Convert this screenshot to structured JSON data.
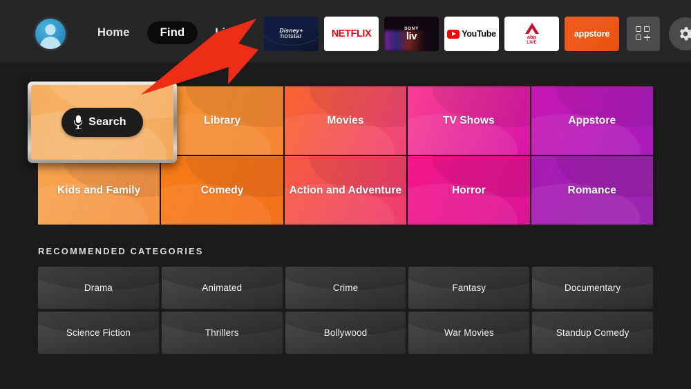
{
  "nav": {
    "avatar_name": "profile-avatar",
    "items": [
      {
        "label": "Home",
        "selected": false
      },
      {
        "label": "Find",
        "selected": true
      },
      {
        "label": "Live",
        "selected": false
      }
    ],
    "apps": [
      {
        "name": "disney-hotstar",
        "line1": "Disney+",
        "line2": "hotstar"
      },
      {
        "name": "netflix",
        "line1": "NETFLIX",
        "line2": ""
      },
      {
        "name": "sony-liv",
        "line1": "SONY",
        "line2": "liv"
      },
      {
        "name": "youtube",
        "line1": "YouTube",
        "line2": ""
      },
      {
        "name": "abp-live",
        "line1": "abp",
        "line2": "LIVE"
      },
      {
        "name": "appstore",
        "line1": "appstore",
        "line2": ""
      }
    ],
    "apps_grid_icon": "apps-grid-plus-icon",
    "settings_icon": "gear-icon"
  },
  "search_tile": {
    "label": "Search",
    "mic_icon": "microphone-icon",
    "focused": true,
    "focus_ring_color": "#b9b8b4",
    "tile_color": "#f4ac5e"
  },
  "categories": [
    {
      "label": "Library",
      "color_from": "#f59331",
      "color_to": "#f58634"
    },
    {
      "label": "Movies",
      "color_from": "#f8662f",
      "color_to": "#f1437b"
    },
    {
      "label": "TV Shows",
      "color_from": "#f83f93",
      "color_to": "#d915a8"
    },
    {
      "label": "Appstore",
      "color_from": "#c818b4",
      "color_to": "#a81bbd"
    },
    {
      "label": "Kids and Family",
      "color_from": "#f8a44f",
      "color_to": "#f59245"
    },
    {
      "label": "Comedy",
      "color_from": "#f77c18",
      "color_to": "#f4701b"
    },
    {
      "label": "Action and Adventure",
      "color_from": "#f65b41",
      "color_to": "#f03b72"
    },
    {
      "label": "Horror",
      "color_from": "#f5168a",
      "color_to": "#da1496"
    },
    {
      "label": "Romance",
      "color_from": "#a81ab5",
      "color_to": "#9a26ad"
    }
  ],
  "recommended": {
    "heading": "RECOMMENDED CATEGORIES",
    "items": [
      {
        "label": "Drama"
      },
      {
        "label": "Animated"
      },
      {
        "label": "Crime"
      },
      {
        "label": "Fantasy"
      },
      {
        "label": "Documentary"
      },
      {
        "label": "Science Fiction"
      },
      {
        "label": "Thrillers"
      },
      {
        "label": "Bollywood"
      },
      {
        "label": "War Movies"
      },
      {
        "label": "Standup Comedy"
      }
    ]
  },
  "annotation": {
    "arrow_color": "#ee2d16",
    "arrow_name": "red-pointer-arrow",
    "points_to": "Search"
  }
}
